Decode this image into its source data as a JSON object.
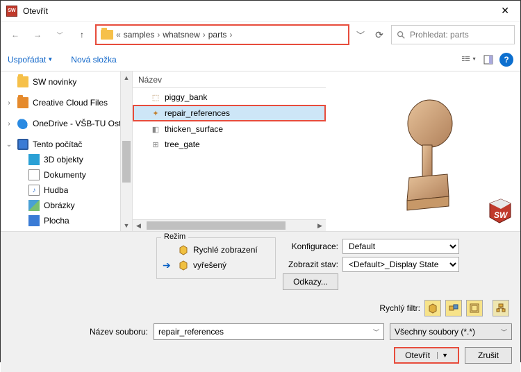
{
  "title": "Otevřít",
  "breadcrumb": {
    "sep1": "«",
    "p1": "samples",
    "p2": "whatsnew",
    "p3": "parts"
  },
  "search": {
    "placeholder": "Prohledat: parts"
  },
  "toolbar": {
    "organize": "Uspořádat",
    "newfolder": "Nová složka"
  },
  "sidebar": {
    "items": [
      {
        "label": "SW novinky"
      },
      {
        "label": "Creative Cloud Files"
      },
      {
        "label": "OneDrive - VŠB-TU Ost"
      },
      {
        "label": "Tento počítač"
      },
      {
        "label": "3D objekty"
      },
      {
        "label": "Dokumenty"
      },
      {
        "label": "Hudba"
      },
      {
        "label": "Obrázky"
      },
      {
        "label": "Plocha"
      }
    ]
  },
  "filelist": {
    "header": "Název",
    "items": [
      {
        "name": "piggy_bank"
      },
      {
        "name": "repair_references"
      },
      {
        "name": "thicken_surface"
      },
      {
        "name": "tree_gate"
      }
    ]
  },
  "mode": {
    "legend": "Režim",
    "quick": "Rychlé zobrazení",
    "resolved": "vyřešený"
  },
  "config": {
    "config_label": "Konfigurace:",
    "config_value": "Default",
    "state_label": "Zobrazit stav:",
    "state_value": "<Default>_Display State"
  },
  "links_btn": "Odkazy...",
  "filter_label": "Rychlý filtr:",
  "file": {
    "name_label": "Název souboru:",
    "name_value": "repair_references",
    "type_value": "Všechny soubory (*.*)"
  },
  "buttons": {
    "open": "Otevřít",
    "cancel": "Zrušit"
  }
}
